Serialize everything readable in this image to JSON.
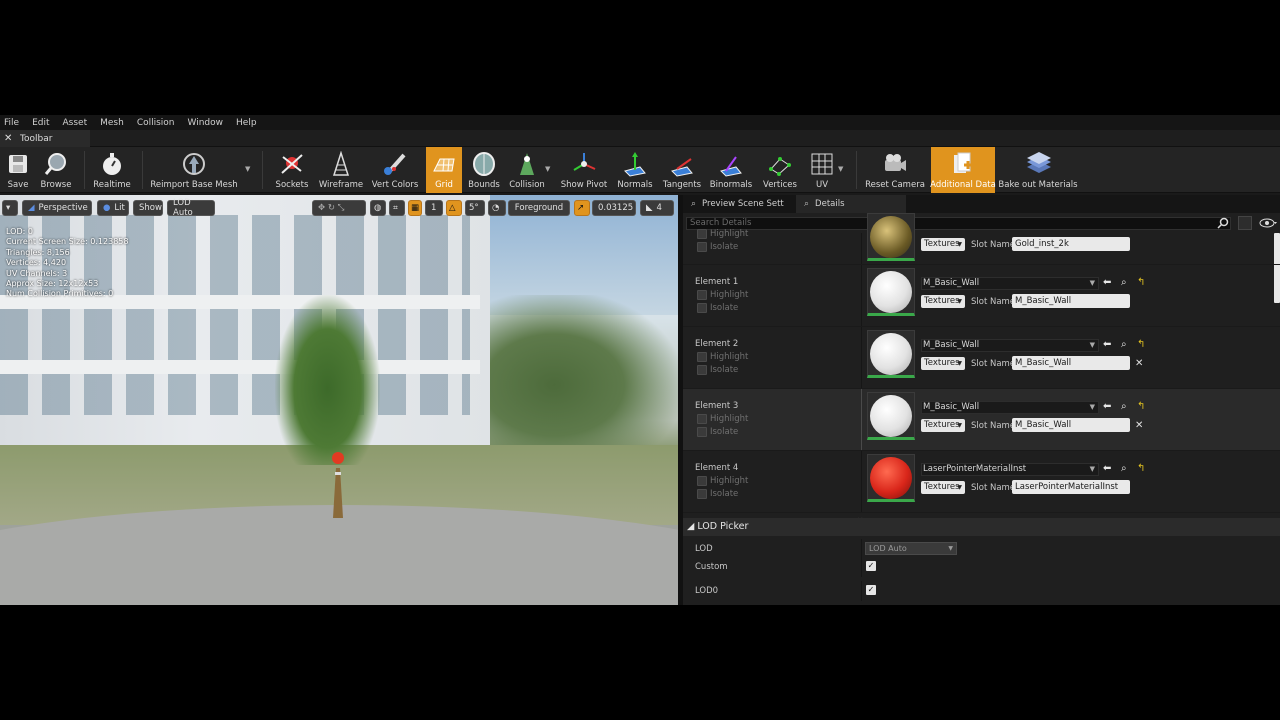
{
  "menu": [
    "File",
    "Edit",
    "Asset",
    "Mesh",
    "Collision",
    "Window",
    "Help"
  ],
  "toolbar_tab": {
    "label": "Toolbar"
  },
  "toolbar": {
    "save": "Save",
    "browse": "Browse",
    "realtime": "Realtime",
    "reimport": "Reimport Base Mesh",
    "sockets": "Sockets",
    "wireframe": "Wireframe",
    "vert_colors": "Vert Colors",
    "grid": "Grid",
    "bounds": "Bounds",
    "collision": "Collision",
    "show_pivot": "Show Pivot",
    "normals": "Normals",
    "tangents": "Tangents",
    "binormals": "Binormals",
    "vertices": "Vertices",
    "uv": "UV",
    "reset_camera": "Reset Camera",
    "additional_data": "Additional Data",
    "bake_out": "Bake out Materials"
  },
  "viewport": {
    "perspective": "Perspective",
    "lit": "Lit",
    "show": "Show",
    "lod_auto": "LOD Auto",
    "snap_value": "1",
    "angle_value": "5°",
    "foreground": "Foreground",
    "scale_value": "0.03125",
    "camera_speed": "4",
    "info": {
      "lod": "LOD:  0",
      "screen_size": "Current Screen Size:  0.123858",
      "triangles": "Triangles:  8,156",
      "vertices": "Vertices:  4,420",
      "uv_channels": "UV Channels:  3",
      "approx_size": "Approx Size: 12x12x53",
      "collision_prims": "Num Collision Primitives:  0"
    }
  },
  "panel": {
    "tabs": [
      "Preview Scene Sett",
      "Details"
    ],
    "search_placeholder": "Search Details",
    "highlight_label": "Highlight",
    "isolate_label": "Isolate",
    "textures_label": "Textures",
    "slot_name_label": "Slot Name",
    "top_slot": "Gold_inst_2k",
    "elements": [
      {
        "name": "Element 1",
        "material": "M_Basic_Wall",
        "slot": "M_Basic_Wall"
      },
      {
        "name": "Element 2",
        "material": "M_Basic_Wall",
        "slot": "M_Basic_Wall"
      },
      {
        "name": "Element 3",
        "material": "M_Basic_Wall",
        "slot": "M_Basic_Wall"
      },
      {
        "name": "Element 4",
        "material": "LaserPointerMaterialInst",
        "slot": "LaserPointerMaterialInst"
      }
    ],
    "lod_picker": {
      "title": "LOD Picker",
      "lod_label": "LOD",
      "lod_value": "LOD Auto",
      "custom_label": "Custom",
      "lod0_label": "LOD0"
    }
  },
  "colors": {
    "accent": "#e0941e",
    "thumb_border": "#3aa84a"
  }
}
